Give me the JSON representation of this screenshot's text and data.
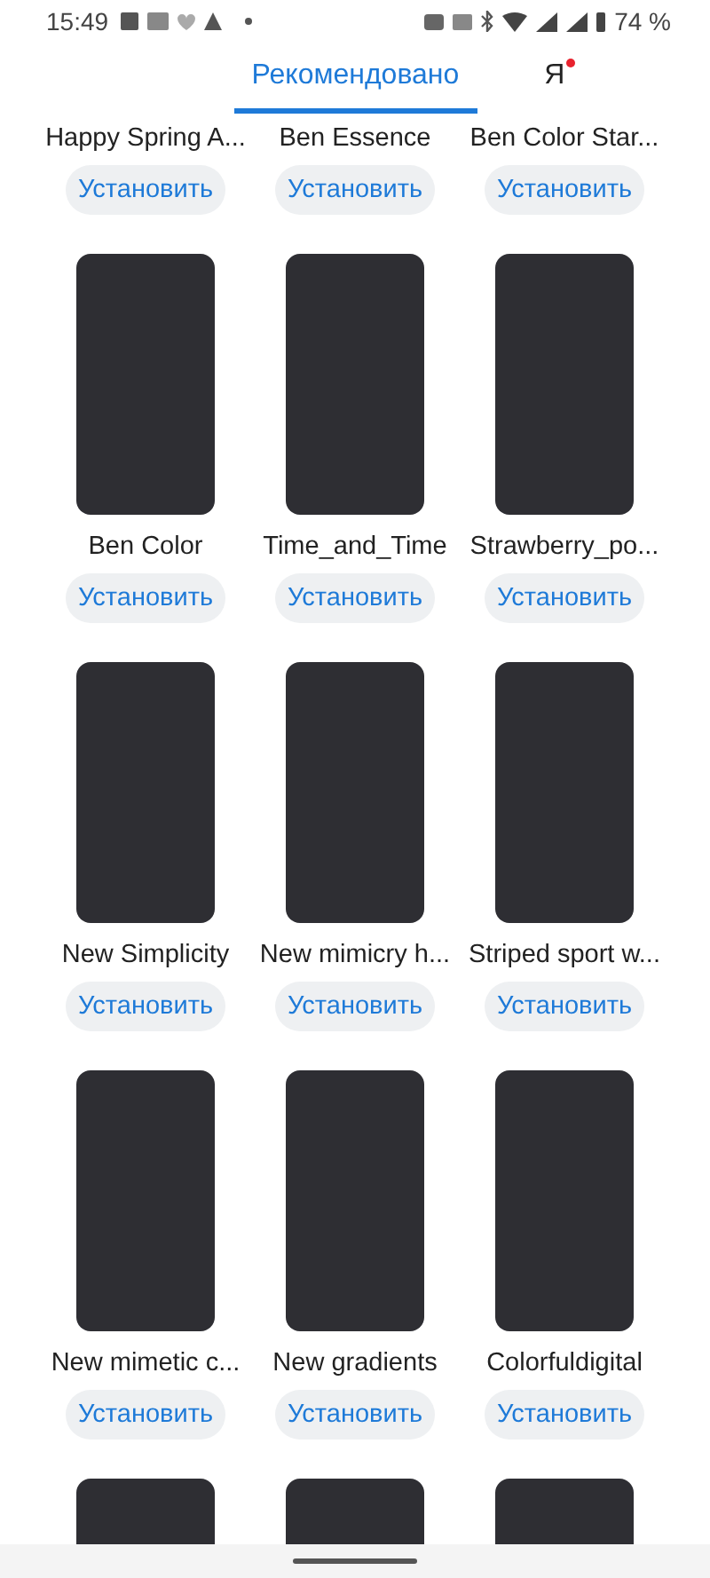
{
  "status_bar": {
    "time": "15:49",
    "battery": "74 %"
  },
  "tabs": [
    {
      "label": "Рекомендовано",
      "selected": true,
      "badge": false
    },
    {
      "label": "Я",
      "selected": false,
      "badge": true
    }
  ],
  "faces": [
    {
      "kind": "top_cut",
      "title": "Happy Spring A...",
      "button": "Установить"
    },
    {
      "kind": "top_cut",
      "title": "Ben Essence",
      "button": "Установить"
    },
    {
      "kind": "top_cut",
      "title": "Ben Color Star...",
      "button": "Установить"
    },
    {
      "kind": "full",
      "title": "Ben Color",
      "button": "Установить"
    },
    {
      "kind": "full",
      "title": "Time_and_Time",
      "button": "Установить"
    },
    {
      "kind": "full",
      "title": "Strawberry_po...",
      "button": "Установить"
    },
    {
      "kind": "full",
      "title": "New Simplicity",
      "button": "Установить"
    },
    {
      "kind": "full",
      "title": "New mimicry h...",
      "button": "Установить"
    },
    {
      "kind": "full",
      "title": "Striped sport w...",
      "button": "Установить"
    },
    {
      "kind": "full",
      "title": "New mimetic c...",
      "button": "Установить"
    },
    {
      "kind": "full",
      "title": "New gradients",
      "button": "Установить"
    },
    {
      "kind": "full",
      "title": "Colorfuldigital",
      "button": "Установить"
    },
    {
      "kind": "bottom_cut"
    },
    {
      "kind": "bottom_cut"
    },
    {
      "kind": "bottom_cut"
    }
  ]
}
